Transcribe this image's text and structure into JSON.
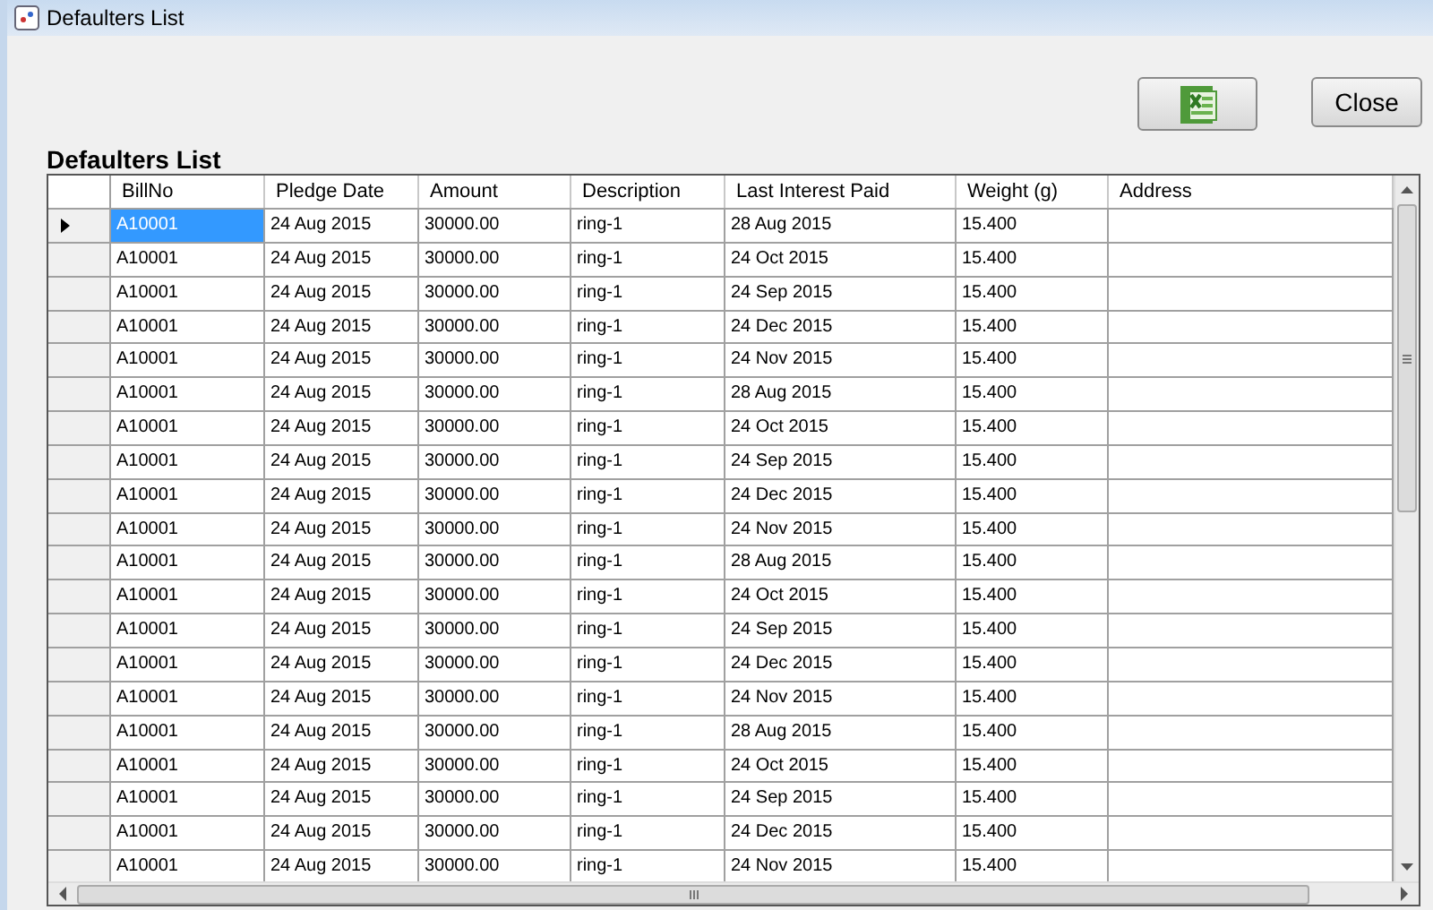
{
  "window": {
    "title": "Defaulters List"
  },
  "heading": "Defaulters List",
  "buttons": [
    {
      "kind": "excel"
    },
    {
      "kind": "text",
      "label": "Close"
    }
  ],
  "table": {
    "columns": [
      "BillNo",
      "Pledge Date",
      "Amount",
      "Description",
      "Last Interest Paid",
      "Weight (g)",
      "Address"
    ],
    "rows": [
      {
        "selected": true,
        "cells": [
          "A10001",
          "24 Aug 2015",
          "30000.00",
          "ring-1",
          "28 Aug 2015",
          "15.400"
        ]
      },
      {
        "selected": false,
        "cells": [
          "A10001",
          "24 Aug 2015",
          "30000.00",
          "ring-1",
          "24 Oct 2015",
          "15.400"
        ]
      },
      {
        "selected": false,
        "cells": [
          "A10001",
          "24 Aug 2015",
          "30000.00",
          "ring-1",
          "24 Sep 2015",
          "15.400"
        ]
      },
      {
        "selected": false,
        "cells": [
          "A10001",
          "24 Aug 2015",
          "30000.00",
          "ring-1",
          "24 Dec 2015",
          "15.400"
        ]
      },
      {
        "selected": false,
        "cells": [
          "A10001",
          "24 Aug 2015",
          "30000.00",
          "ring-1",
          "24 Nov 2015",
          "15.400"
        ]
      },
      {
        "selected": false,
        "cells": [
          "A10001",
          "24 Aug 2015",
          "30000.00",
          "ring-1",
          "28 Aug 2015",
          "15.400"
        ]
      },
      {
        "selected": false,
        "cells": [
          "A10001",
          "24 Aug 2015",
          "30000.00",
          "ring-1",
          "24 Oct 2015",
          "15.400"
        ]
      },
      {
        "selected": false,
        "cells": [
          "A10001",
          "24 Aug 2015",
          "30000.00",
          "ring-1",
          "24 Sep 2015",
          "15.400"
        ]
      },
      {
        "selected": false,
        "cells": [
          "A10001",
          "24 Aug 2015",
          "30000.00",
          "ring-1",
          "24 Dec 2015",
          "15.400"
        ]
      },
      {
        "selected": false,
        "cells": [
          "A10001",
          "24 Aug 2015",
          "30000.00",
          "ring-1",
          "24 Nov 2015",
          "15.400"
        ]
      },
      {
        "selected": false,
        "cells": [
          "A10001",
          "24 Aug 2015",
          "30000.00",
          "ring-1",
          "28 Aug 2015",
          "15.400"
        ]
      },
      {
        "selected": false,
        "cells": [
          "A10001",
          "24 Aug 2015",
          "30000.00",
          "ring-1",
          "24 Oct 2015",
          "15.400"
        ]
      },
      {
        "selected": false,
        "cells": [
          "A10001",
          "24 Aug 2015",
          "30000.00",
          "ring-1",
          "24 Sep 2015",
          "15.400"
        ]
      },
      {
        "selected": false,
        "cells": [
          "A10001",
          "24 Aug 2015",
          "30000.00",
          "ring-1",
          "24 Dec 2015",
          "15.400"
        ]
      },
      {
        "selected": false,
        "cells": [
          "A10001",
          "24 Aug 2015",
          "30000.00",
          "ring-1",
          "24 Nov 2015",
          "15.400"
        ]
      },
      {
        "selected": false,
        "cells": [
          "A10001",
          "24 Aug 2015",
          "30000.00",
          "ring-1",
          "28 Aug 2015",
          "15.400"
        ]
      },
      {
        "selected": false,
        "cells": [
          "A10001",
          "24 Aug 2015",
          "30000.00",
          "ring-1",
          "24 Oct 2015",
          "15.400"
        ]
      },
      {
        "selected": false,
        "cells": [
          "A10001",
          "24 Aug 2015",
          "30000.00",
          "ring-1",
          "24 Sep 2015",
          "15.400"
        ]
      },
      {
        "selected": false,
        "cells": [
          "A10001",
          "24 Aug 2015",
          "30000.00",
          "ring-1",
          "24 Dec 2015",
          "15.400"
        ]
      },
      {
        "selected": false,
        "cells": [
          "A10001",
          "24 Aug 2015",
          "30000.00",
          "ring-1",
          "24 Nov 2015",
          "15.400"
        ]
      }
    ]
  }
}
